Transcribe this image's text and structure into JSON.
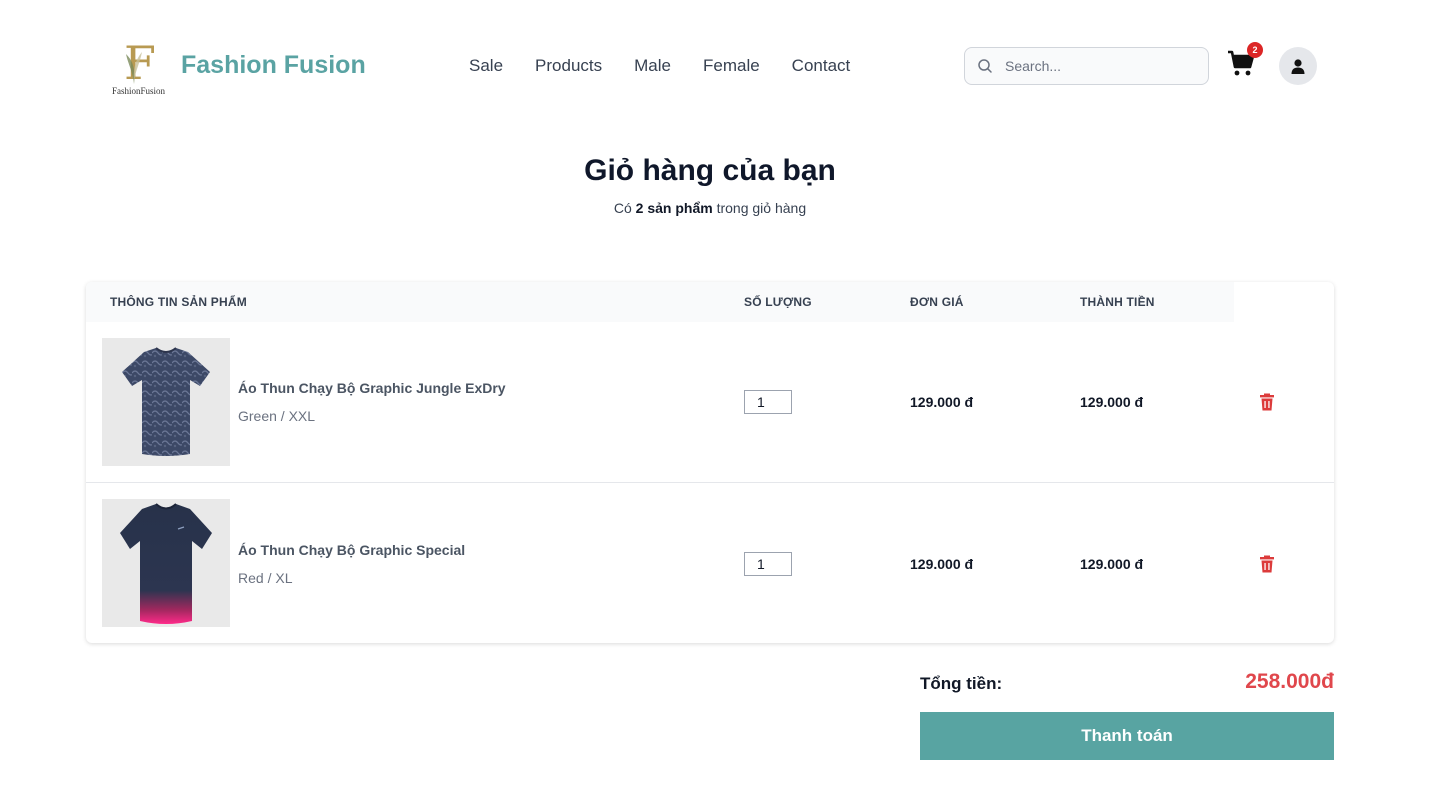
{
  "header": {
    "brand": "Fashion Fusion",
    "logo_letter": "F",
    "logo_sub": "FashionFusion",
    "nav": [
      "Sale",
      "Products",
      "Male",
      "Female",
      "Contact"
    ],
    "search_placeholder": "Search...",
    "cart_count": "2",
    "icons": {
      "search": "search-icon",
      "cart": "cart-icon",
      "user": "user-icon"
    }
  },
  "page": {
    "title": "Giỏ hàng của bạn",
    "subtitle_prefix": "Có",
    "subtitle_bold": "2 sản phẩm",
    "subtitle_suffix": "trong giỏ hàng"
  },
  "table": {
    "headers": {
      "product": "THÔNG TIN SẢN PHẨM",
      "quantity": "SỐ LƯỢNG",
      "unit_price": "ĐƠN GIÁ",
      "subtotal": "THÀNH TIỀN"
    },
    "rows": [
      {
        "name": "Áo Thun Chạy Bộ Graphic Jungle ExDry",
        "variant": "Green / XXL",
        "quantity": "1",
        "unit_price": "129.000 đ",
        "subtotal": "129.000 đ"
      },
      {
        "name": "Áo Thun Chạy Bộ Graphic Special",
        "variant": "Red / XL",
        "quantity": "1",
        "unit_price": "129.000 đ",
        "subtotal": "129.000 đ"
      }
    ]
  },
  "summary": {
    "total_label": "Tổng tiền:",
    "total_value": "258.000đ",
    "checkout_label": "Thanh toán"
  },
  "colors": {
    "brand": "#5aa3a3",
    "checkout": "#58a4a2",
    "total": "#e0474c",
    "trash": "#dc3b3b",
    "badge": "#dc2626"
  }
}
